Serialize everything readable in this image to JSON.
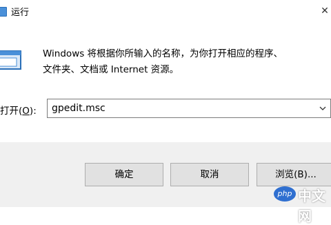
{
  "window": {
    "title": "运行",
    "close_glyph": "✕"
  },
  "dialog": {
    "message_line1": "Windows 将根据你所输入的名称，为你打开相应的程序、",
    "message_line2": "文件夹、文档或 Internet 资源。",
    "open_label_prefix": "打开(",
    "open_label_key": "O",
    "open_label_suffix": "):",
    "command_value": "gpedit.msc"
  },
  "buttons": {
    "ok": "确定",
    "cancel": "取消",
    "browse": "浏览(B)..."
  },
  "watermark": {
    "logo": "php",
    "text": "中文网"
  },
  "icons": {
    "app": "run-dialog-icon",
    "big": "run-dialog-icon",
    "dropdown": "chevron-down-icon",
    "close": "close-icon"
  },
  "colors": {
    "footer_bg": "#f0f0f0",
    "button_bg": "#e1e1e1",
    "icon_blue": "#4a90d9"
  }
}
